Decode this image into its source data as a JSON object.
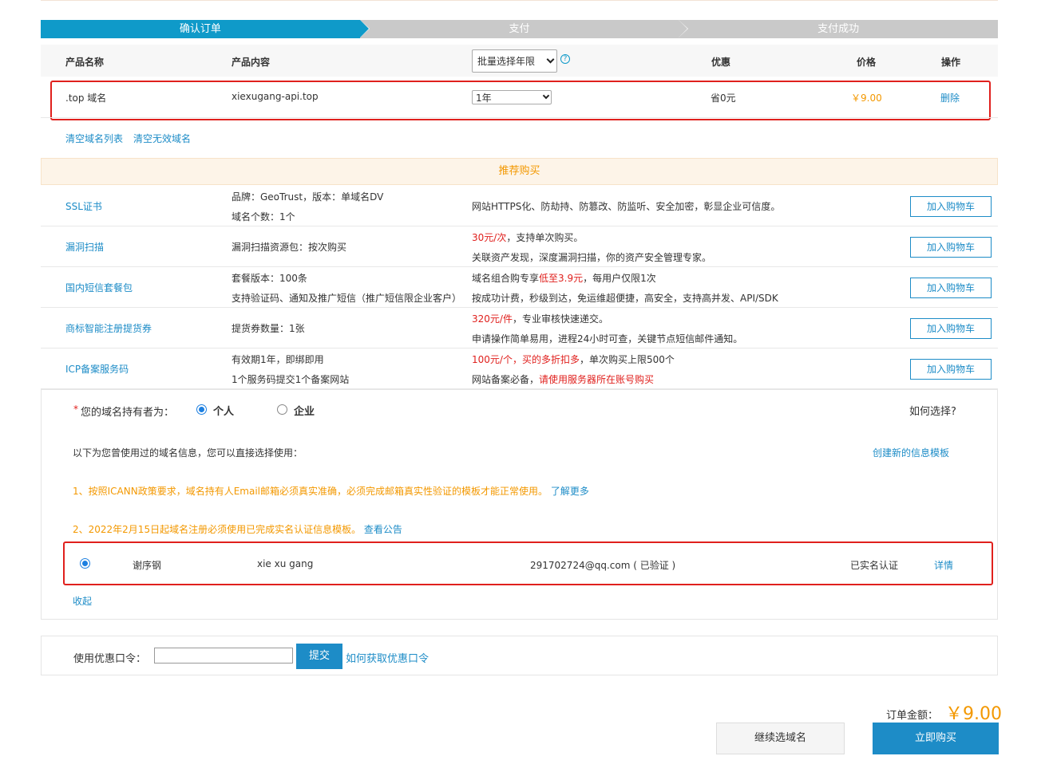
{
  "steps": [
    "确认订单",
    "支付",
    "支付成功"
  ],
  "table": {
    "headers": {
      "name": "产品名称",
      "content": "产品内容",
      "batch_select": "批量选择年限",
      "discount": "优惠",
      "price": "价格",
      "action": "操作"
    },
    "row": {
      "name": ".top 域名",
      "content": "xiexugang-api.top",
      "years": "1年",
      "discount": "省0元",
      "price": "￥9.00",
      "action": "删除"
    }
  },
  "clear_links": {
    "clear_list": "清空域名列表",
    "clear_invalid": "清空无效域名"
  },
  "recommend": {
    "title": "推荐购买",
    "items": [
      {
        "name": "SSL证书",
        "spec1": "品牌：GeoTrust，版本：单域名DV",
        "spec2": "域名个数：1个",
        "desc1": "网站HTTPS化、防劫持、防篡改、防监听、安全加密，彰显企业可信度。",
        "desc2": "",
        "button": "加入购物车"
      },
      {
        "name": "漏洞扫描",
        "spec1": "漏洞扫描资源包：按次购买",
        "spec2": "",
        "desc1_red": "30元/次",
        "desc1_rest": "，支持单次购买。",
        "desc2": "关联资产发现，深度漏洞扫描，你的资产安全管理专家。",
        "button": "加入购物车"
      },
      {
        "name": "国内短信套餐包",
        "spec1": "套餐版本：100条",
        "spec2": "支持验证码、通知及推广短信（推广短信限企业客户）",
        "desc1_a": "域名组合购专享",
        "desc1_red": "低至3.9元",
        "desc1_b": "，每用户仅限1次",
        "desc2": "按成功计费，秒级到达，免运维超便捷，高安全，支持高并发、API/SDK",
        "button": "加入购物车"
      },
      {
        "name": "商标智能注册提货券",
        "spec1": "提货券数量：1张",
        "spec2": "",
        "desc1_red": "320元/件",
        "desc1_rest": "，专业审核快速递交。",
        "desc2": "申请操作简单易用，进程24小时可查，关键节点短信邮件通知。",
        "button": "加入购物车"
      },
      {
        "name": "ICP备案服务码",
        "spec1": "有效期1年，即绑即用",
        "spec2": "1个服务码提交1个备案网站",
        "desc1_red": "100元/个，买的多折扣多",
        "desc1_rest": "，单次购买上限500个",
        "desc2_a": "网站备案必备，",
        "desc2_red": "请使用服务器所在账号购买",
        "button": "加入购物车"
      }
    ]
  },
  "holder": {
    "required_mark": "*",
    "label": "您的域名持有者为：",
    "option_personal": "个人",
    "option_company": "企业",
    "how_to_choose": "如何选择?",
    "intro": "以下为您曾使用过的域名信息，您可以直接选择使用：",
    "create_template": "创建新的信息模板",
    "notice1": "1、按照ICANN政策要求，域名持有人Email邮箱必须真实准确，必须完成邮箱真实性验证的模板才能正常使用。",
    "notice1_link": "了解更多",
    "notice2": "2、2022年2月15日起域名注册必须使用已完成实名认证信息模板。",
    "notice2_link": "查看公告",
    "template": {
      "name_cn": "谢序钢",
      "name_en": "xie xu gang",
      "email": "291702724@qq.com ( 已验证 )",
      "status": "已实名认证",
      "detail": "详情"
    },
    "collapse": "收起"
  },
  "coupon": {
    "label": "使用优惠口令：",
    "value": "",
    "submit": "提交",
    "how": "如何获取优惠口令"
  },
  "total": {
    "label": "订单金额：",
    "amount": "￥9.00"
  },
  "actions": {
    "continue": "继续选域名",
    "buy": "立即购买"
  },
  "colors": {
    "accent": "#0f9ac9",
    "link": "#1d8cc7",
    "orange": "#f39800",
    "red": "#e0201d",
    "highlight_box": "#e0201d"
  }
}
